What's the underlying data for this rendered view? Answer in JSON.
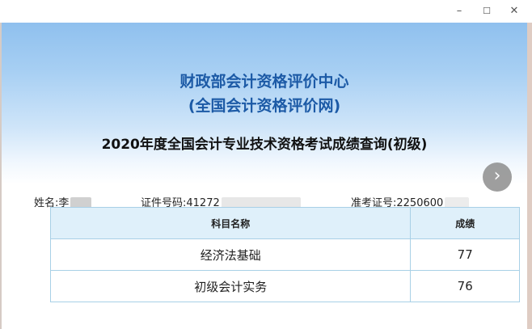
{
  "window": {
    "minimize": "–",
    "maximize": "☐",
    "close": "✕"
  },
  "org": {
    "line1": "财政部会计资格评价中心",
    "line2": "(全国会计资格评价网)"
  },
  "heading": "2020年度全国会计专业技术资格考试成绩查询(初级)",
  "nav": {
    "next_icon": "›"
  },
  "candidate": {
    "name_label": "姓名:",
    "name_value": "李",
    "id_label": "证件号码:",
    "id_value": "41272",
    "exam_label": "准考证号:",
    "exam_value": "2250600"
  },
  "table": {
    "headers": [
      "科目名称",
      "成绩"
    ],
    "rows": [
      {
        "subject": "经济法基础",
        "score": "77"
      },
      {
        "subject": "初级会计实务",
        "score": "76"
      }
    ]
  }
}
